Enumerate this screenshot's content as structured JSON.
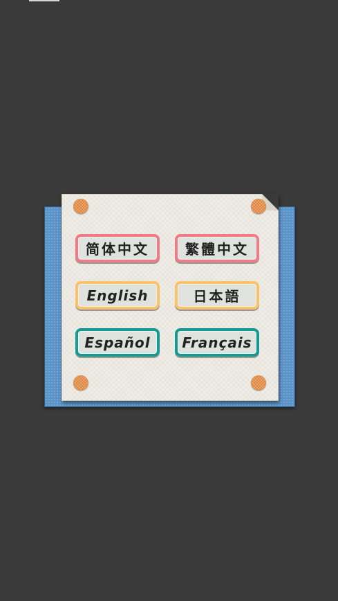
{
  "language_menu": {
    "buttons": [
      {
        "label": "简体中文",
        "color": "#f07b84"
      },
      {
        "label": "繁體中文",
        "color": "#f07b84"
      },
      {
        "label": "English",
        "color": "#f9c16a"
      },
      {
        "label": "日本語",
        "color": "#f9c16a"
      },
      {
        "label": "Español",
        "color": "#159a92"
      },
      {
        "label": "Français",
        "color": "#159a92"
      }
    ]
  },
  "colors": {
    "background": "#3a3a3a",
    "back_card": "#5a93c8",
    "paper": "#efede6",
    "pin": "#f4a86a"
  }
}
